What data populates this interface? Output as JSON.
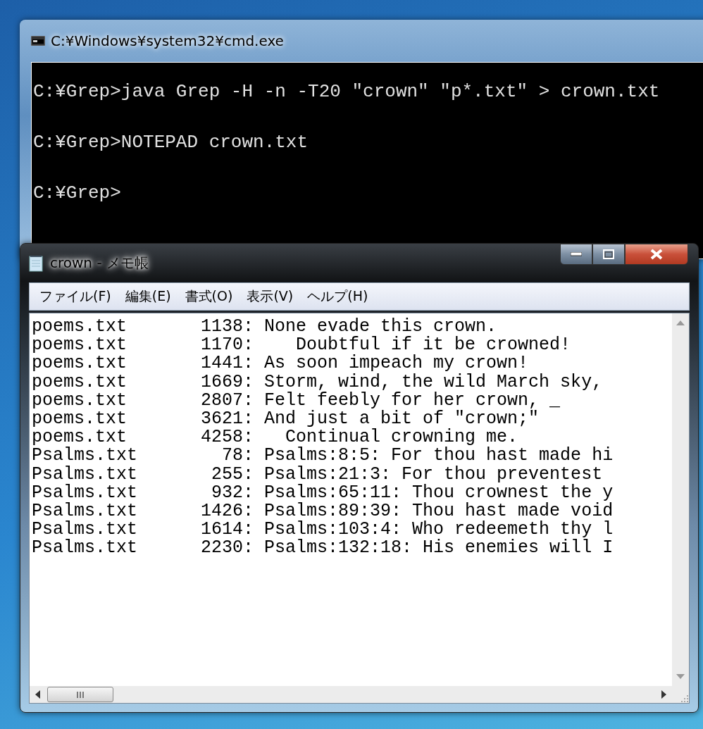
{
  "cmd_window": {
    "title": "C:¥Windows¥system32¥cmd.exe",
    "lines": [
      "C:¥Grep>java Grep -H -n -T20 \"crown\" \"p*.txt\" > crown.txt",
      "C:¥Grep>NOTEPAD crown.txt",
      "C:¥Grep>"
    ]
  },
  "notepad": {
    "title": "crown - メモ帳",
    "menu": [
      "ファイル(F)",
      "編集(E)",
      "書式(O)",
      "表示(V)",
      "ヘルプ(H)"
    ],
    "lines": [
      "poems.txt       1138: None evade this crown.",
      "poems.txt       1170:    Doubtful if it be crowned!",
      "poems.txt       1441: As soon impeach my crown!",
      "poems.txt       1669: Storm, wind, the wild March sky,",
      "poems.txt       2807: Felt feebly for her crown, _",
      "poems.txt       3621: And just a bit of \"crown;\"",
      "poems.txt       4258:   Continual crowning me.",
      "Psalms.txt        78: Psalms:8:5: For thou hast made hi",
      "Psalms.txt       255: Psalms:21:3: For thou preventest",
      "Psalms.txt       932: Psalms:65:11: Thou crownest the y",
      "Psalms.txt      1426: Psalms:89:39: Thou hast made void",
      "Psalms.txt      1614: Psalms:103:4: Who redeemeth thy l",
      "Psalms.txt      2230: Psalms:132:18: His enemies will I"
    ]
  }
}
